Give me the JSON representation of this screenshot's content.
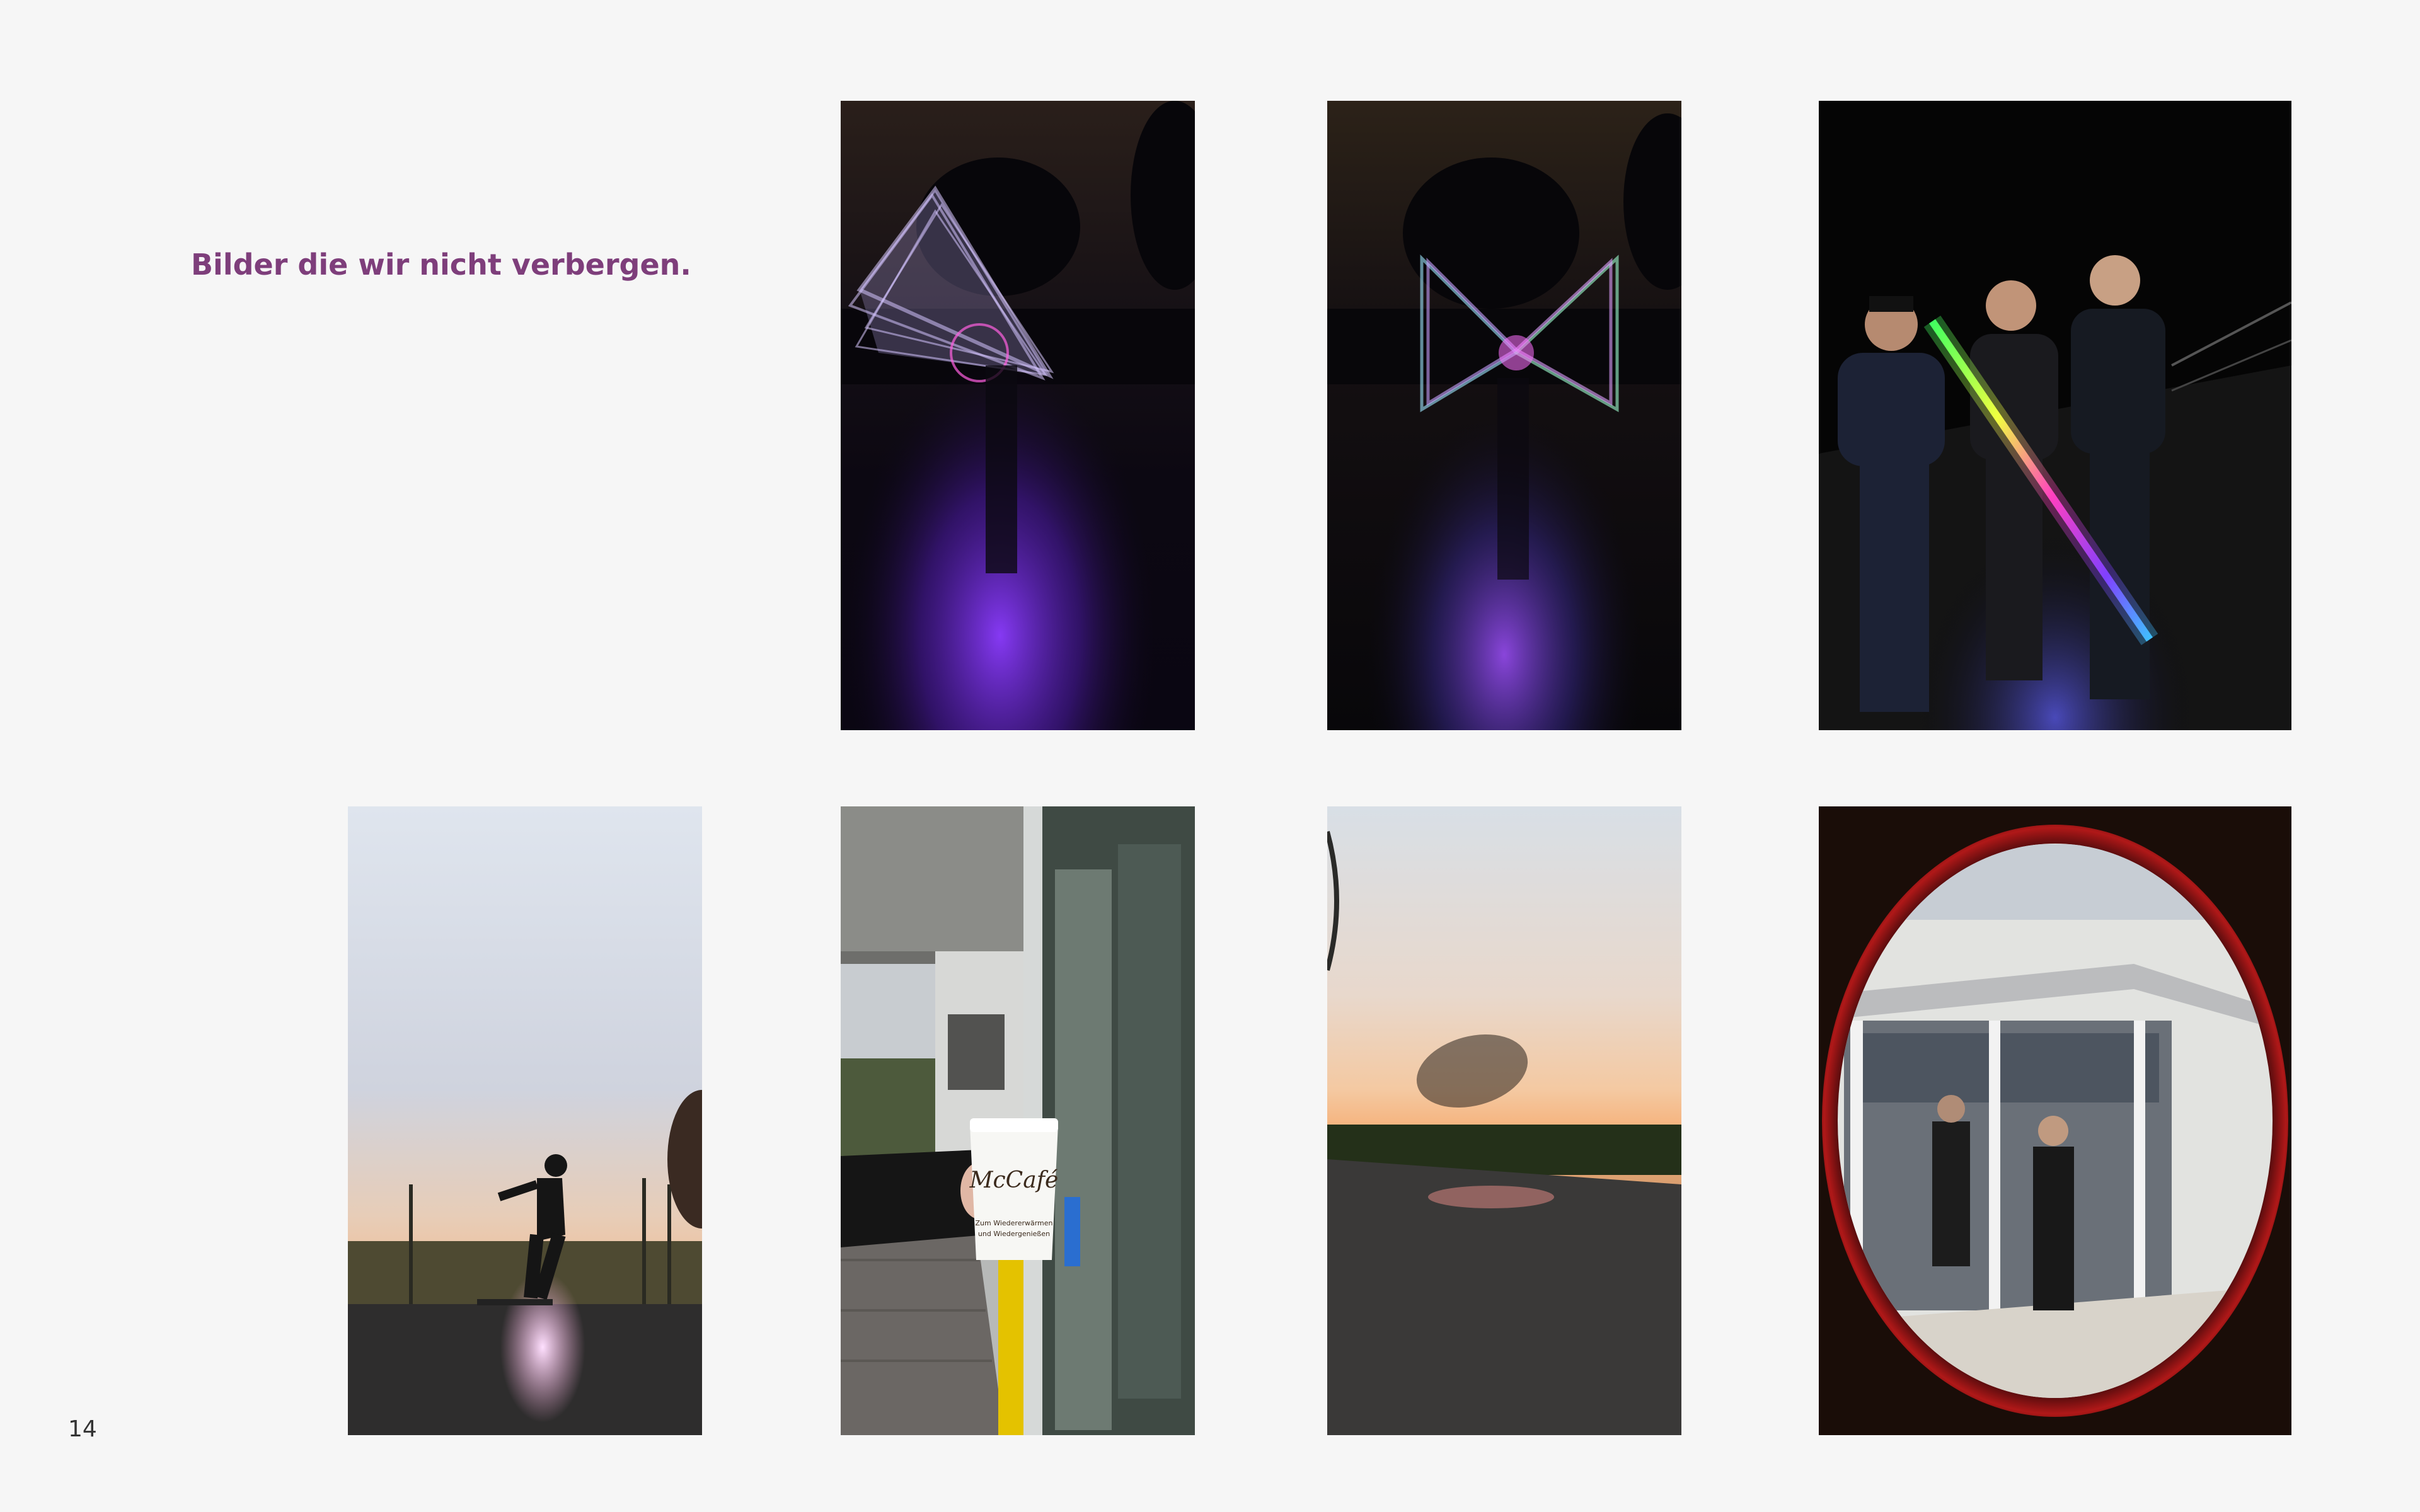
{
  "page": {
    "heading": "Bilder die wir nicht verbergen.",
    "page_number": "14"
  },
  "colors": {
    "background": "#f6f6f6",
    "heading": "#7e3e7b",
    "page_number": "#333333"
  },
  "photos": [
    {
      "name": "lightpainting-triangle-photo"
    },
    {
      "name": "lightpainting-bowtie-photo"
    },
    {
      "name": "neon-lightsaber-group-photo"
    },
    {
      "name": "skateboarder-sunset-photo"
    },
    {
      "name": "mccafe-cup-photo"
    },
    {
      "name": "motion-blur-road-photo"
    },
    {
      "name": "fisheye-entrance-photo"
    }
  ],
  "cup": {
    "brand": "McCafé",
    "slogan_line1": "Zum Wiedererwärmen",
    "slogan_line2": "und Wiedergenießen"
  }
}
